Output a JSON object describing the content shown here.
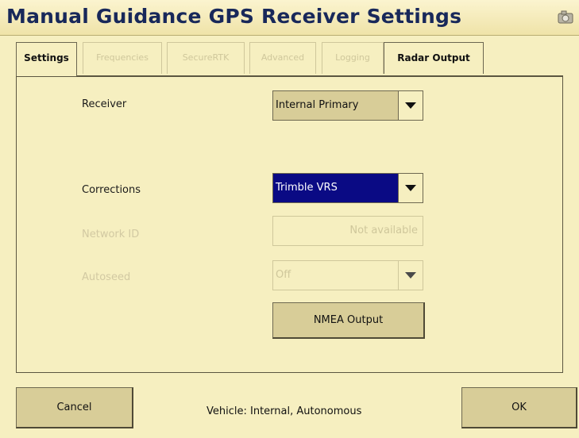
{
  "window": {
    "title": "Manual Guidance GPS Receiver Settings",
    "title_icon": "settings-icon"
  },
  "tabs": [
    {
      "label": "Settings",
      "state": "active"
    },
    {
      "label": "Frequencies",
      "state": "disabled"
    },
    {
      "label": "SecureRTK",
      "state": "disabled"
    },
    {
      "label": "Advanced",
      "state": "disabled"
    },
    {
      "label": "Logging",
      "state": "disabled"
    },
    {
      "label": "Radar Output",
      "state": "enabled"
    }
  ],
  "form": {
    "receiver": {
      "label": "Receiver",
      "value": "Internal Primary"
    },
    "corrections": {
      "label": "Corrections",
      "value": "Trimble VRS"
    },
    "network_id": {
      "label": "Network ID",
      "value": "Not available"
    },
    "autoseed": {
      "label": "Autoseed",
      "value": "Off"
    },
    "nmea_button": "NMEA Output"
  },
  "footer": {
    "cancel_label": "Cancel",
    "status_text": "Vehicle: Internal, Autonomous",
    "ok_label": "OK"
  },
  "colors": {
    "background": "#f6efc0",
    "button": "#d8cd98",
    "title_text": "#18285a",
    "selection": "#0a0a84",
    "disabled_text": "#cfc79b"
  }
}
